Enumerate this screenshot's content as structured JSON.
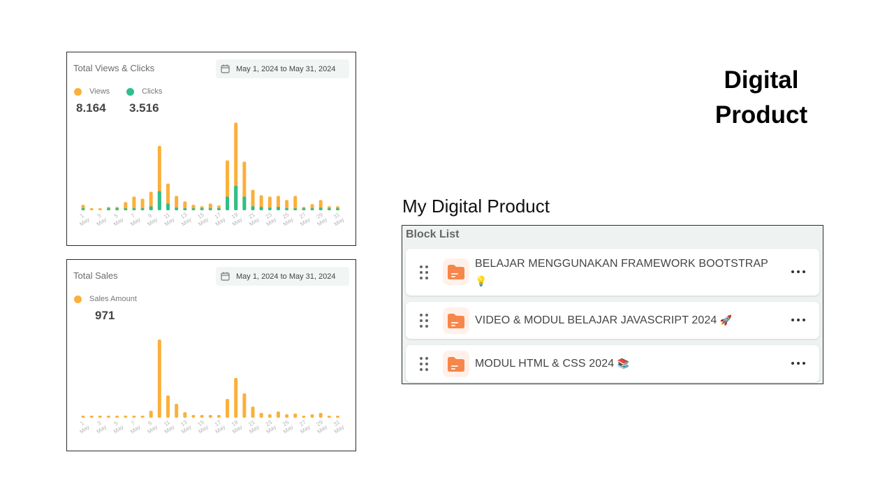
{
  "heading": {
    "line1": "Digital",
    "line2": "Product"
  },
  "views_clicks_panel": {
    "title": "Total Views & Clicks",
    "date_range": "May 1, 2024 to May 31, 2024",
    "legend": [
      {
        "label": "Views",
        "color": "#fbb03b"
      },
      {
        "label": "Clicks",
        "color": "#2fbf8a"
      }
    ],
    "views_total": "8.164",
    "clicks_total": "3.516"
  },
  "sales_panel": {
    "title": "Total Sales",
    "date_range": "May 1, 2024 to May 31, 2024",
    "legend_label": "Sales Amount",
    "sales_total": "971"
  },
  "chart_data": [
    {
      "type": "bar",
      "title": "Total Views & Clicks",
      "categories": [
        "1 May",
        "2 May",
        "3 May",
        "4 May",
        "5 May",
        "6 May",
        "7 May",
        "8 May",
        "9 May",
        "10 May",
        "11 May",
        "12 May",
        "13 May",
        "14 May",
        "15 May",
        "16 May",
        "17 May",
        "18 May",
        "19 May",
        "20 May",
        "21 May",
        "22 May",
        "23 May",
        "24 May",
        "25 May",
        "26 May",
        "27 May",
        "28 May",
        "29 May",
        "30 May",
        "31 May"
      ],
      "tick_labels": [
        "1",
        "3",
        "5",
        "7",
        "9",
        "11",
        "13",
        "15",
        "17",
        "19",
        "21",
        "23",
        "25",
        "27",
        "29",
        "31"
      ],
      "tick_sublabel": "May",
      "series": [
        {
          "name": "Views",
          "color": "#fbb03b",
          "values": [
            8,
            2,
            2,
            5,
            5,
            12,
            20,
            17,
            27,
            94,
            39,
            21,
            13,
            8,
            6,
            10,
            7,
            73,
            128,
            71,
            30,
            22,
            20,
            21,
            15,
            21,
            5,
            9,
            15,
            6,
            6
          ]
        },
        {
          "name": "Clicks",
          "color": "#2fbf8a",
          "values": [
            1,
            0,
            0,
            1,
            1,
            2,
            3,
            3,
            6,
            28,
            10,
            4,
            3,
            2,
            2,
            2,
            2,
            20,
            36,
            20,
            6,
            5,
            4,
            5,
            3,
            3,
            1,
            2,
            4,
            1,
            1
          ]
        }
      ],
      "stacked": true,
      "grid": false
    },
    {
      "type": "bar",
      "title": "Total Sales",
      "categories": [
        "1 May",
        "2 May",
        "3 May",
        "4 May",
        "5 May",
        "6 May",
        "7 May",
        "8 May",
        "9 May",
        "10 May",
        "11 May",
        "12 May",
        "13 May",
        "14 May",
        "15 May",
        "16 May",
        "17 May",
        "18 May",
        "19 May",
        "20 May",
        "21 May",
        "22 May",
        "23 May",
        "24 May",
        "25 May",
        "26 May",
        "27 May",
        "28 May",
        "29 May",
        "30 May",
        "31 May"
      ],
      "tick_labels": [
        "1",
        "3",
        "5",
        "7",
        "9",
        "11",
        "13",
        "15",
        "17",
        "19",
        "21",
        "23",
        "25",
        "27",
        "29",
        "31"
      ],
      "tick_sublabel": "May",
      "series": [
        {
          "name": "Sales Amount",
          "color": "#fbb03b",
          "values": [
            0,
            0,
            0,
            0,
            0,
            0,
            0,
            0,
            10,
            112,
            32,
            20,
            8,
            4,
            4,
            4,
            4,
            27,
            57,
            35,
            16,
            7,
            5,
            9,
            5,
            6,
            2,
            5,
            7,
            3,
            3
          ]
        }
      ],
      "grid": false
    }
  ],
  "section_title": "My Digital Product",
  "block_list": {
    "title": "Block List",
    "items": [
      {
        "label": "BELAJAR MENGGUNAKAN FRAMEWORK BOOTSTRAP",
        "emoji": "💡"
      },
      {
        "label": "VIDEO & MODUL BELAJAR JAVASCRIPT 2024",
        "emoji": "🚀"
      },
      {
        "label": "MODUL HTML & CSS 2024",
        "emoji": "📚"
      }
    ]
  },
  "icons": {
    "calendar": "calendar-icon",
    "drag": "drag-handle-icon",
    "folder": "folder-icon",
    "more": "more-horizontal-icon"
  },
  "colors": {
    "views": "#fbb03b",
    "clicks": "#2fbf8a",
    "folder": "#f7864a"
  }
}
